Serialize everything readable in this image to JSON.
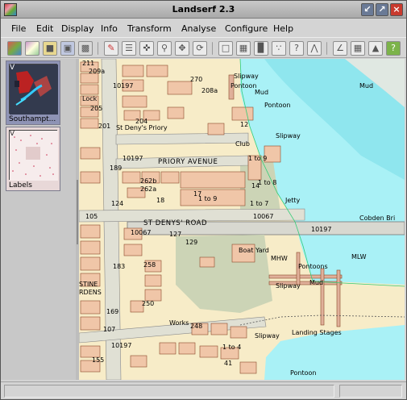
{
  "window": {
    "title": "Landserf 2.3"
  },
  "menu": [
    {
      "label": "File",
      "key": "F"
    },
    {
      "label": "Edit",
      "key": "E"
    },
    {
      "label": "Display",
      "key": "D"
    },
    {
      "label": "Info",
      "key": "I"
    },
    {
      "label": "Transform",
      "key": "T"
    },
    {
      "label": "Analyse",
      "key": "A"
    },
    {
      "label": "Configure",
      "key": "C"
    },
    {
      "label": "Help",
      "key": "H"
    }
  ],
  "toolbar": {
    "icons": [
      "new-raster-icon",
      "new-vector-icon",
      "open-folder-icon",
      "save-icon",
      "print-icon",
      "edit-pencil-icon",
      "edit-attributes-icon",
      "crosshair-icon",
      "zoom-icon",
      "pan-icon",
      "refresh-icon",
      "comment-icon",
      "stats-icon",
      "histogram-icon",
      "scatter-icon",
      "query-icon",
      "profile-icon",
      "slope-icon",
      "grid-icon",
      "terrain-icon",
      "help-icon"
    ]
  },
  "sidebar": {
    "thumbnails": [
      {
        "label": "Southampt...",
        "badge": "V"
      },
      {
        "label": "Labels",
        "badge": "V"
      }
    ]
  },
  "map": {
    "labels": [
      "211",
      "209a",
      "Slipway",
      "Pontoon",
      "Mud",
      "270",
      "208a",
      "Mud",
      "Pontoon",
      "10197",
      "Lock",
      "205",
      "201",
      "St Deny's Priory",
      "204",
      "Slipway",
      "12",
      "Club",
      "10197",
      "PRIORY AVENUE",
      "1 to 9",
      "189",
      "262b",
      "262a",
      "14",
      "1 to 8",
      "Jetty",
      "18",
      "17",
      "1 to 9",
      "1 to 7",
      "10067",
      "105",
      "ST DENYS' ROAD",
      "Cobden Bri",
      "127",
      "10197",
      "129",
      "Boat Yard",
      "MHW",
      "MLW",
      "183",
      "258",
      "Pontoons",
      "STINE",
      "RDENS",
      "Slipway",
      "Mud",
      "250",
      "169",
      "Works",
      "248",
      "107",
      "Slipway",
      "Landing Stages",
      "155",
      "1 to 4",
      "41",
      "Pontoon",
      "10197",
      "10067",
      "124"
    ]
  },
  "colors": {
    "water": "#a9f1f6",
    "water_deep": "#8fe6ee",
    "land": "#f7ecc8",
    "building": "#f0c6a8",
    "building_outline": "#8b4a2a",
    "road": "#e0e0d4",
    "park": "#ccd4b6",
    "mud": "#e0e8e2"
  },
  "status": {
    "left": "",
    "right": ""
  }
}
